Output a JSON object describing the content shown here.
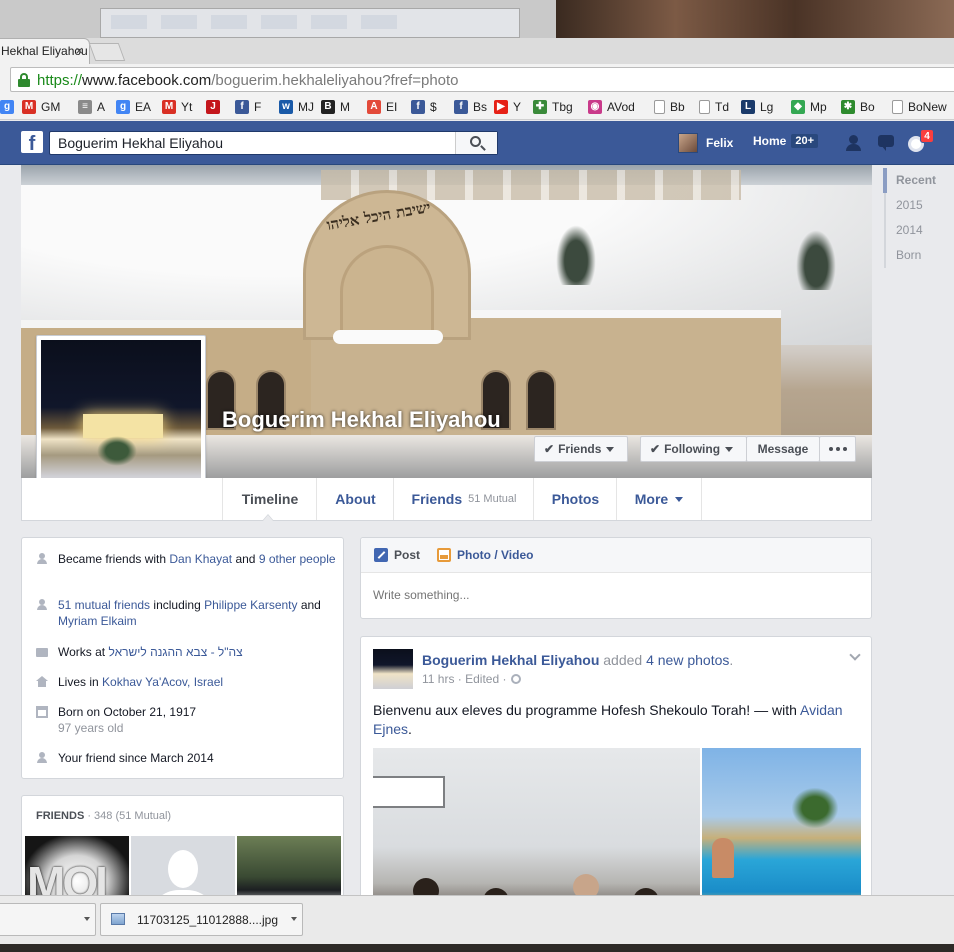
{
  "browser": {
    "tab_title": "Hekhal Eliyahou",
    "tab_close": "×",
    "url_scheme": "https://",
    "url_host": "www.facebook.com",
    "url_path": "/boguerim.hekhaleliyahou?fref=photo",
    "bookmarks": [
      {
        "label": "",
        "icon": "google-icon",
        "color": "#4285f4",
        "glyph": "g"
      },
      {
        "label": "GM",
        "icon": "gmail-icon",
        "color": "#d93025",
        "glyph": "M"
      },
      {
        "label": "A",
        "icon": "news-icon",
        "color": "#8a8a8a",
        "glyph": "≡"
      },
      {
        "label": "EA",
        "icon": "google-icon",
        "color": "#4285f4",
        "glyph": "g"
      },
      {
        "label": "Yt",
        "icon": "gmail-icon",
        "color": "#d93025",
        "glyph": "M"
      },
      {
        "label": "",
        "icon": "j-icon",
        "color": "#c4161c",
        "glyph": "J"
      },
      {
        "label": "F",
        "icon": "facebook-icon",
        "color": "#3b5998",
        "glyph": "f"
      },
      {
        "label": "MJ",
        "icon": "weather-icon",
        "color": "#1a5aa8",
        "glyph": "w"
      },
      {
        "label": "M",
        "icon": "bbc-icon",
        "color": "#222222",
        "glyph": "B"
      },
      {
        "label": "EI",
        "icon": "acrobat-icon",
        "color": "#e34a3a",
        "glyph": "A"
      },
      {
        "label": "$",
        "icon": "facebook-icon",
        "color": "#3b5998",
        "glyph": "f"
      },
      {
        "label": "Bs",
        "icon": "facebook-icon",
        "color": "#3b5998",
        "glyph": "f"
      },
      {
        "label": "Y",
        "icon": "youtube-icon",
        "color": "#e62117",
        "glyph": "▶"
      },
      {
        "label": "Tbg",
        "icon": "puzzle-icon",
        "color": "#3a8a3a",
        "glyph": "✚"
      },
      {
        "label": "AVod",
        "icon": "avod-icon",
        "color": "#c93a8a",
        "glyph": "◉"
      },
      {
        "label": "Bb",
        "icon": "page-icon",
        "color": "#9a9a9a",
        "glyph": ""
      },
      {
        "label": "Td",
        "icon": "page-icon",
        "color": "#9a9a9a",
        "glyph": ""
      },
      {
        "label": "Lg",
        "icon": "lg-icon",
        "color": "#1a3a6a",
        "glyph": "L"
      },
      {
        "label": "Mp",
        "icon": "maps-icon",
        "color": "#34a853",
        "glyph": "◆"
      },
      {
        "label": "Bo",
        "icon": "bo-icon",
        "color": "#2e8b2e",
        "glyph": "✱"
      },
      {
        "label": "BoNew",
        "icon": "page-icon",
        "color": "#9a9a9a",
        "glyph": ""
      }
    ]
  },
  "fb": {
    "search_value": "Boguerim Hekhal Eliyahou",
    "user_name": "Felix",
    "home_label": "Home",
    "home_count": "20+",
    "notif_count": "4"
  },
  "cover": {
    "hebrew_sign": "ישיבת היכל אליהו"
  },
  "page": {
    "name": "Boguerim Hekhal Eliyahou",
    "btn_friends": "Friends",
    "btn_following": "Following",
    "btn_message": "Message",
    "check": "✔"
  },
  "nav": {
    "timeline": "Timeline",
    "about": "About",
    "friends": "Friends",
    "friends_mutual": "51 Mutual",
    "photos": "Photos",
    "more": "More"
  },
  "scrubber": [
    "Recent",
    "2015",
    "2014",
    "Born"
  ],
  "about": {
    "r1_prefix": "Became friends with ",
    "r1_link1": "Dan Khayat",
    "r1_mid": " and ",
    "r1_link2": "9 other people",
    "r2_link1": "51 mutual friends",
    "r2_mid": " including ",
    "r2_link2": "Philippe Karsenty",
    "r2_and": " and ",
    "r2_link3": "Myriam Elkaim",
    "r3_prefix": "Works at ",
    "r3_link": "צה\"ל - צבא ההגנה לישראל",
    "r4_prefix": "Lives in ",
    "r4_link": "Kokhav Ya'Acov, Israel",
    "r5_text": "Born on October 21, 1917",
    "r5_sub": "97 years old",
    "r6_text": "Your friend since March 2014"
  },
  "friends_box": {
    "title": "FRIENDS",
    "count": " · 348 (51 Mutual)",
    "moi_text": "MOI"
  },
  "composer": {
    "post": "Post",
    "photo_video": "Photo / Video",
    "placeholder": "Write something..."
  },
  "story": {
    "author": "Boguerim Hekhal Eliyahou",
    "action_prefix": " added ",
    "action_link": "4 new photos",
    "action_suffix": ".",
    "time": "11 hrs · Edited · ",
    "message": "Bienvenu aux eleves du programme Hofesh Shekoulo Torah! — with ",
    "with_link": "Avidan Ejnes",
    "message_end": "."
  },
  "downloads": {
    "file": "11703125_11012888....jpg"
  }
}
